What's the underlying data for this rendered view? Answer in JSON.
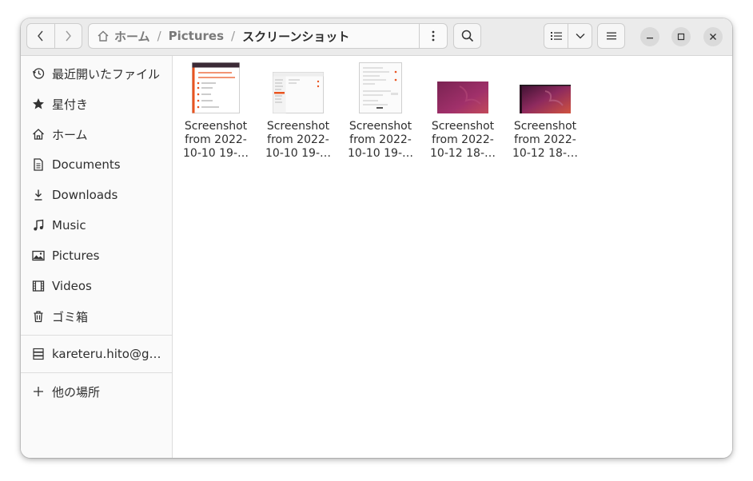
{
  "header": {
    "path": [
      {
        "label": "ホーム"
      },
      {
        "label": "Pictures"
      },
      {
        "label": "スクリーンショット"
      }
    ]
  },
  "sidebar": {
    "items": [
      {
        "label": "最近開いたファイル",
        "icon": "clock-icon"
      },
      {
        "label": "星付き",
        "icon": "star-icon"
      },
      {
        "label": "ホーム",
        "icon": "home-icon"
      },
      {
        "label": "Documents",
        "icon": "document-icon"
      },
      {
        "label": "Downloads",
        "icon": "download-icon"
      },
      {
        "label": "Music",
        "icon": "music-icon"
      },
      {
        "label": "Pictures",
        "icon": "picture-icon"
      },
      {
        "label": "Videos",
        "icon": "video-icon"
      },
      {
        "label": "ゴミ箱",
        "icon": "trash-icon"
      }
    ],
    "network": {
      "label": "kareteru.hito@g…",
      "icon": "server-icon"
    },
    "other": {
      "label": "他の場所",
      "icon": "plus-icon"
    }
  },
  "files": [
    {
      "line1": "Screenshot",
      "line2": "from 2022-",
      "line3": "10-10 19-…"
    },
    {
      "line1": "Screenshot",
      "line2": "from 2022-",
      "line3": "10-10 19-…"
    },
    {
      "line1": "Screenshot",
      "line2": "from 2022-",
      "line3": "10-10 19-…"
    },
    {
      "line1": "Screenshot",
      "line2": "from 2022-",
      "line3": "10-12 18-…"
    },
    {
      "line1": "Screenshot",
      "line2": "from 2022-",
      "line3": "10-12 18-…"
    }
  ],
  "colors": {
    "accent": "#e95420",
    "wallpaper": "#8e2a5e"
  }
}
